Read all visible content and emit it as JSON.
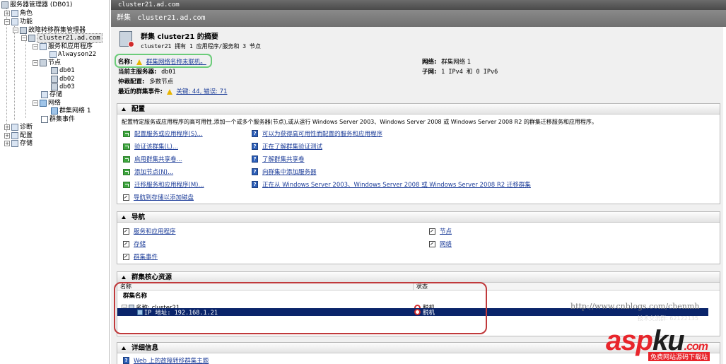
{
  "tree": {
    "root": "服务器管理器 (DB01)",
    "roles": "角色",
    "features": "功能",
    "failover_mgr": "故障转移群集管理器",
    "cluster": "cluster21.ad.com",
    "services_apps": "服务和应用程序",
    "always_on": "Alwayson22",
    "nodes": "节点",
    "node_items": [
      "db01",
      "db02",
      "db03"
    ],
    "storage": "存储",
    "networks": "网络",
    "network_item": "群集网络 1",
    "cluster_events": "群集事件",
    "diagnostics": "诊断",
    "configuration": "配置",
    "storage_root": "存储"
  },
  "header": {
    "topbar": "cluster21.ad.com",
    "title_prefix": "群集",
    "title_name": "cluster21.ad.com"
  },
  "summary": {
    "title": "群集 cluster21 的摘要",
    "subtitle": "cluster21 拥有 1 应用程序/服务和 3 节点",
    "name_label": "名称:",
    "name_value": "群集网络名称未联机。",
    "host_label": "当前主服务器:",
    "host_value": "db01",
    "quorum_label": "仲裁配置:",
    "quorum_value": "多数节点",
    "events_label": "最近的群集事件:",
    "events_value": "关键: 44, 错误: 71",
    "network_label": "网络:",
    "network_value": "群集网络 1",
    "subnet_label": "子网:",
    "subnet_value": "1 IPv4 和 0 IPv6"
  },
  "config": {
    "title": "配置",
    "description": "配置特定服务或应用程序的高可用性,添加一个或多个服务器(节点),或从运行 Windows Server 2003、Windows Server 2008 或 Windows Server 2008 R2 的群集迁移服务和应用程序。",
    "actions": [
      "配置服务或应用程序(S)...",
      "验证该群集(L)...",
      "启用群集共享卷...",
      "添加节点(N)...",
      "迁移服务和应用程序(M)...",
      "导航到存储以添加磁盘"
    ],
    "help_links": [
      "可以为获得高可用性而配置的服务和应用程序",
      "正在了解群集验证测试",
      "了解群集共享卷",
      "向群集中添加服务器",
      "正在从 Windows Server 2003、Windows Server 2008 或 Windows Server 2008 R2 迁移群集"
    ]
  },
  "navigate": {
    "title": "导航",
    "left": [
      "服务和应用程序",
      "存储",
      "群集事件"
    ],
    "right": [
      "节点",
      "网络"
    ]
  },
  "core": {
    "title": "群集核心资源",
    "col_name": "名称",
    "col_status": "状态",
    "group_label": "群集名称",
    "name_row_label": "名称: cluster21",
    "name_row_status": "脱机",
    "ip_row_label": "IP 地址: 192.168.1.21",
    "ip_row_status": "脱机"
  },
  "details": {
    "title": "详细信息",
    "first_line": "Web 上的故障转移群集主题"
  },
  "watermarks": {
    "blog_url": "http://www.cnblogs.com/chenmh",
    "support": "技术交流群: 62122135",
    "logo_a": "asp",
    "logo_b": "ku",
    "logo_c": ".com",
    "logo_sub": "免费网站源码下载站"
  }
}
